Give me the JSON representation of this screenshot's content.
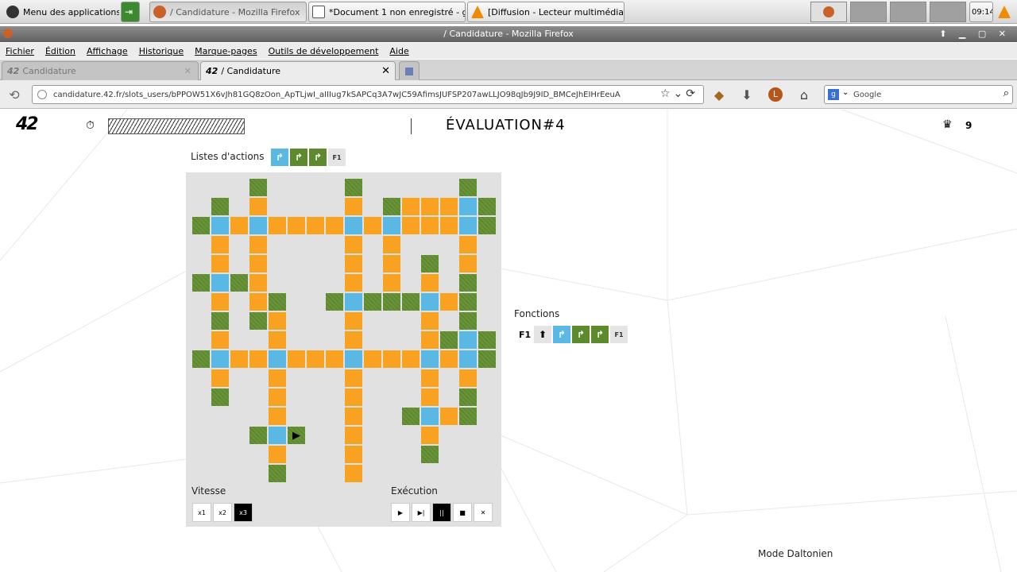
{
  "taskbar": {
    "apps_menu": "Menu des applications",
    "windows": [
      {
        "label": "/ Candidature - Mozilla Firefox",
        "active": true
      },
      {
        "label": "*Document 1 non enregistré - g...",
        "active": false
      },
      {
        "label": "[Diffusion - Lecteur multimédia ...",
        "active": false
      }
    ],
    "clock": "09:14"
  },
  "titlebar": {
    "title": "/ Candidature - Mozilla Firefox"
  },
  "menubar": {
    "items": [
      "Fichier",
      "Édition",
      "Affichage",
      "Historique",
      "Marque-pages",
      "Outils de développement",
      "Aide"
    ]
  },
  "tabs": [
    {
      "label": "Candidature"
    },
    {
      "label": "/ Candidature"
    }
  ],
  "navbar": {
    "url": "candidature.42.fr/slots_users/bPPOW51X6vJh81GQ8zOon_ApTLjwI_aIIIug7kSAPCq3A7wJC59AfimsJUFSP207awLLJO98qJb9J9ID_BMCeJhEIHrEeuA",
    "search_placeholder": "Google"
  },
  "header": {
    "logo": "42",
    "title": "ÉVALUATION#4",
    "score": "9"
  },
  "actions": {
    "label": "Listes d'actions",
    "f_label": "F1"
  },
  "functions": {
    "label": "Fonctions",
    "f1_label": "F1",
    "f_label": "F1"
  },
  "speed": {
    "label": "Vitesse",
    "buttons": [
      "x1",
      "x2",
      "x3"
    ],
    "selected": "x3"
  },
  "execution": {
    "label": "Exécution",
    "buttons": [
      "▶",
      "▶|",
      "||",
      "■",
      "✕"
    ]
  },
  "footer": {
    "daltonien": "Mode Daltonien"
  },
  "colors": {
    "orange": "#f9a121",
    "blue": "#5ab8e4",
    "green": "#5d8a2c"
  }
}
